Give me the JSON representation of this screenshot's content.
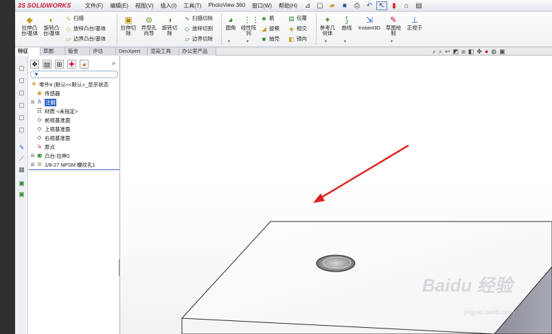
{
  "app": {
    "logo_text": "SOLIDWORKS",
    "logo_prefix": "3S"
  },
  "menu": {
    "items": [
      "文件(F)",
      "编辑(E)",
      "视图(V)",
      "插入(I)",
      "工具(T)",
      "PhotoView 360",
      "窗口(W)",
      "帮助(H)"
    ]
  },
  "ribbon": {
    "extrude_boss": "拉伸凸\n台/基体",
    "revolve_boss": "旋转凸\n台/基体",
    "sweep": "扫描",
    "loft_boss": "放样凸台/基体",
    "boundary_boss": "边界凸台/基体",
    "extrude_cut": "拉伸切\n除",
    "hole_wizard": "异型孔\n向导",
    "revolve_cut": "旋转切\n除",
    "swept_cut": "扫描切除",
    "lofted_cut": "放样切割",
    "boundary_cut": "边界切除",
    "fillet": "圆角",
    "linear_pattern": "线性阵\n列",
    "rib": "筋",
    "draft": "拔模",
    "shell": "抽壳",
    "wrap": "包覆",
    "intersect": "相交",
    "mirror": "镜向",
    "reference_geometry": "参考几\n何体",
    "curves": "曲线",
    "instant3d": "Instant3D",
    "sketch": "草图绘\n制",
    "normal_to": "正视于"
  },
  "tabs": [
    "特征",
    "草图",
    "钣金",
    "评估",
    "DimXpert",
    "渲染工具",
    "办公室产品"
  ],
  "active_tab": "特征",
  "tree": {
    "part": "零件4 (默认<<默认>_显示状态",
    "sensors": "传感器",
    "annotations": "注解",
    "material": "材质 <未指定>",
    "front_plane": "前视基准面",
    "top_plane": "上视基准面",
    "right_plane": "右视基准面",
    "origin": "原点",
    "boss_extrude": "凸台-拉伸2",
    "thread_hole": "1/8-27 NPSM 螺纹孔1"
  },
  "watermark": {
    "brand": "Baidu 经验",
    "url": "jingyan.baidu.com"
  },
  "colors": {
    "accent": "#2a64c5",
    "arrow": "#e02020",
    "logo": "#c8102e"
  }
}
